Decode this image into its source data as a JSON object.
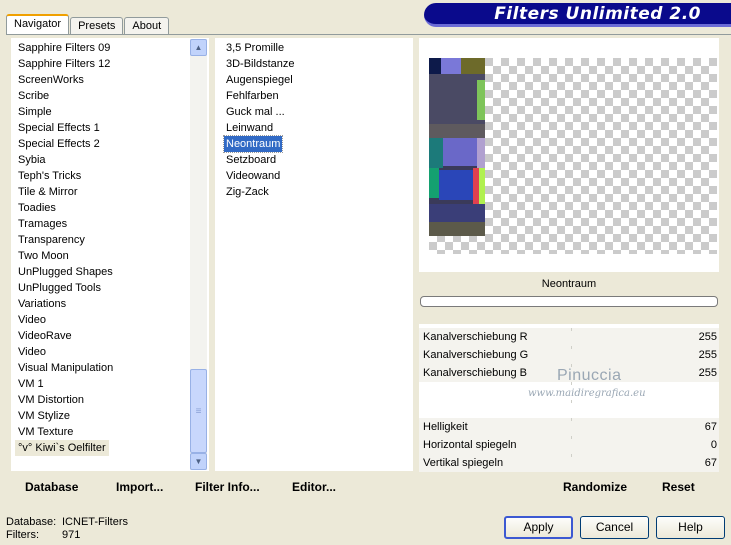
{
  "tabs": [
    {
      "label": "Navigator",
      "active": true
    },
    {
      "label": "Presets",
      "active": false
    },
    {
      "label": "About",
      "active": false
    }
  ],
  "banner": {
    "title": "Filters Unlimited 2.0"
  },
  "categories": [
    "Sapphire Filters 09",
    "Sapphire Filters 12",
    "ScreenWorks",
    "Scribe",
    "Simple",
    "Special Effects 1",
    "Special Effects 2",
    "Sybia",
    "Teph's Tricks",
    "Tile & Mirror",
    "Toadies",
    "Tramages",
    "Transparency",
    "Two Moon",
    "UnPlugged Shapes",
    "UnPlugged Tools",
    "Variations",
    "Video",
    "VideoRave",
    "Video",
    "Visual Manipulation",
    "VM 1",
    "VM Distortion",
    "VM Stylize",
    "VM Texture",
    "°v° Kiwi`s Oelfilter"
  ],
  "selected_category": "°v° Kiwi`s Oelfilter",
  "filters": [
    "3,5 Promille",
    "3D-Bildstanze",
    "Augenspiegel",
    "Fehlfarben",
    "Guck mal ...",
    "Leinwand",
    "Neontraum",
    "Setzboard",
    "Videowand",
    "Zig-Zack"
  ],
  "selected_filter": "Neontraum",
  "preview": {
    "filter_name": "Neontraum"
  },
  "sliders": [
    {
      "label": "Kanalverschiebung R",
      "value": "255"
    },
    {
      "label": "Kanalverschiebung G",
      "value": "255"
    },
    {
      "label": "Kanalverschiebung B",
      "value": "255"
    },
    {
      "label": "",
      "value": ""
    },
    {
      "label": "",
      "value": ""
    },
    {
      "label": "Helligkeit",
      "value": "67"
    },
    {
      "label": "Horizontal spiegeln",
      "value": "0"
    },
    {
      "label": "Vertikal spiegeln",
      "value": "67"
    }
  ],
  "watermark": {
    "name": "Pinuccia",
    "site": "www.maidiregrafica.eu"
  },
  "toolbar_left": {
    "database": "Database",
    "import": "Import...",
    "filter_info": "Filter Info...",
    "editor": "Editor..."
  },
  "toolbar_right": {
    "randomize": "Randomize",
    "reset": "Reset"
  },
  "status": {
    "database_label": "Database:",
    "database_value": "ICNET-Filters",
    "filters_label": "Filters:",
    "filters_value": "971"
  },
  "buttons": {
    "apply": "Apply",
    "cancel": "Cancel",
    "help": "Help"
  },
  "colors": {
    "banner": "#0a0a8c",
    "selection": "#316ac5",
    "window": "#ece9d8"
  }
}
